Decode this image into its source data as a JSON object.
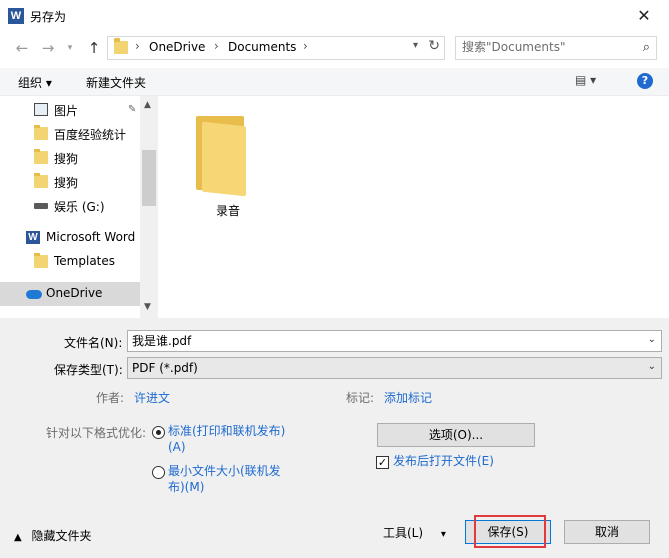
{
  "window": {
    "title": "另存为",
    "app_icon": "word-icon",
    "close_glyph": "✕"
  },
  "address": {
    "crumbs": [
      "OneDrive",
      "Documents"
    ],
    "search_placeholder": "搜索\"Documents\""
  },
  "toolbar": {
    "organize_label": "组织 ▾",
    "new_folder_label": "新建文件夹"
  },
  "nav": {
    "items": [
      {
        "label": "图片",
        "icon": "pictures-icon"
      },
      {
        "label": "百度经验统计",
        "icon": "folder-icon"
      },
      {
        "label": "搜狗",
        "icon": "folder-icon"
      },
      {
        "label": "搜狗",
        "icon": "folder-icon"
      },
      {
        "label": "娱乐 (G:)",
        "icon": "drive-icon"
      },
      {
        "label": "Microsoft Word",
        "icon": "word-icon"
      },
      {
        "label": "Templates",
        "icon": "folder-icon"
      },
      {
        "label": "OneDrive",
        "icon": "onedrive-icon"
      }
    ]
  },
  "content": {
    "items": [
      {
        "label": "录音",
        "icon": "folder-icon"
      }
    ]
  },
  "form": {
    "filename_label": "文件名(N):",
    "filename_value": "我是谁.pdf",
    "filetype_label": "保存类型(T):",
    "filetype_value": "PDF (*.pdf)",
    "author_label": "作者:",
    "author_value": "许进文",
    "tags_label": "标记:",
    "tags_link": "添加标记",
    "optimize_label": "针对以下格式优化:",
    "option_standard_line1": "标准(打印和联机发布)",
    "option_standard_line2": "(A)",
    "option_min_line1": "最小文件大小(联机发",
    "option_min_line2": "布)(M)",
    "options_button": "选项(O)...",
    "open_after_label": "发布后打开文件(E)",
    "open_after_checked": true
  },
  "footer": {
    "hide_folders_label": "隐藏文件夹",
    "tools_label": "工具(L)",
    "save_label": "保存(S)",
    "cancel_label": "取消"
  },
  "colors": {
    "accent": "#1e6ad0",
    "highlight": "#e0393e"
  }
}
